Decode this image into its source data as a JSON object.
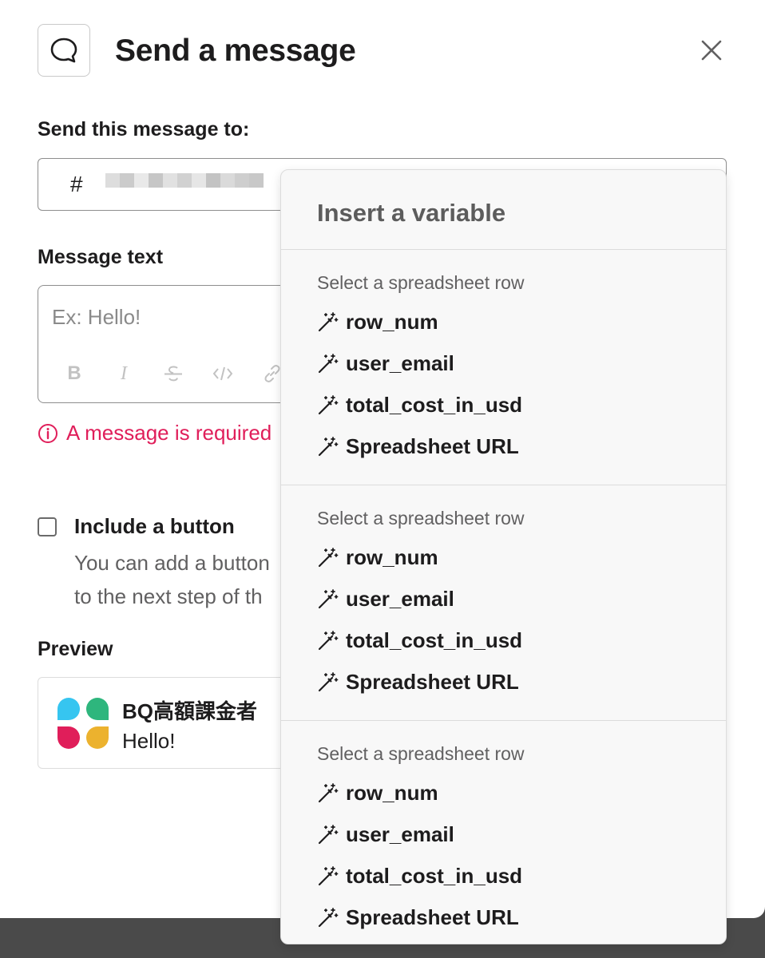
{
  "header": {
    "title": "Send a message"
  },
  "recipient": {
    "label": "Send this message to:",
    "hash": "#"
  },
  "message": {
    "label": "Message text",
    "placeholder": "Ex: Hello!",
    "error": "A message is required"
  },
  "formatting": {
    "bold": "B",
    "italic": "I"
  },
  "button_option": {
    "title": "Include a button",
    "description_line1": "You can add a button",
    "description_line2": "to the next step of th"
  },
  "preview": {
    "label": "Preview",
    "app_name": "BQ高額課金者",
    "message": "Hello!"
  },
  "variable_menu": {
    "title": "Insert a variable",
    "sections": [
      {
        "heading": "Select a spreadsheet row",
        "items": [
          "row_num",
          "user_email",
          "total_cost_in_usd",
          "Spreadsheet URL"
        ]
      },
      {
        "heading": "Select a spreadsheet row",
        "items": [
          "row_num",
          "user_email",
          "total_cost_in_usd",
          "Spreadsheet URL"
        ]
      },
      {
        "heading": "Select a spreadsheet row",
        "items": [
          "row_num",
          "user_email",
          "total_cost_in_usd",
          "Spreadsheet URL"
        ]
      }
    ]
  },
  "colors": {
    "error": "#e01e5a",
    "logo_blue": "#36c5f0",
    "logo_green": "#2eb67d",
    "logo_red": "#e01e5a",
    "logo_yellow": "#ecb22e"
  },
  "icons": {
    "header": "message-bubble-icon",
    "close": "close-icon",
    "error": "info-circle-icon",
    "variable": "magic-wand-icon"
  }
}
